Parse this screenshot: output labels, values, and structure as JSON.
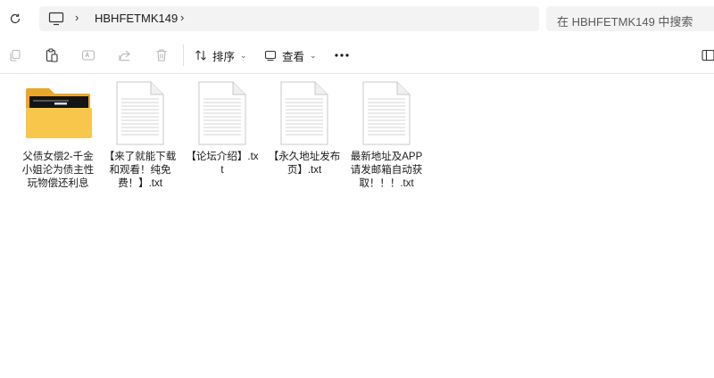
{
  "address_bar": {
    "breadcrumb": [
      "HBHFETMK149"
    ],
    "search_placeholder": "在 HBHFETMK149 中搜索"
  },
  "toolbar": {
    "sort_label": "排序",
    "view_label": "查看"
  },
  "files": [
    {
      "name": "父债女偿2-千金小姐沦为债主性玩物偿还利息",
      "type": "folder"
    },
    {
      "name": "【来了就能下载和观看！纯免费！】.txt",
      "type": "txt"
    },
    {
      "name": "【论坛介绍】.txt",
      "type": "txt"
    },
    {
      "name": "【永久地址发布页】.txt",
      "type": "txt"
    },
    {
      "name": "最新地址及APP请发邮箱自动获取！！！.txt",
      "type": "txt"
    }
  ],
  "colors": {
    "folder_body": "#f7c64b",
    "folder_back": "#e9a628",
    "toolbar_icon_disabled": "#b8b8b8"
  }
}
